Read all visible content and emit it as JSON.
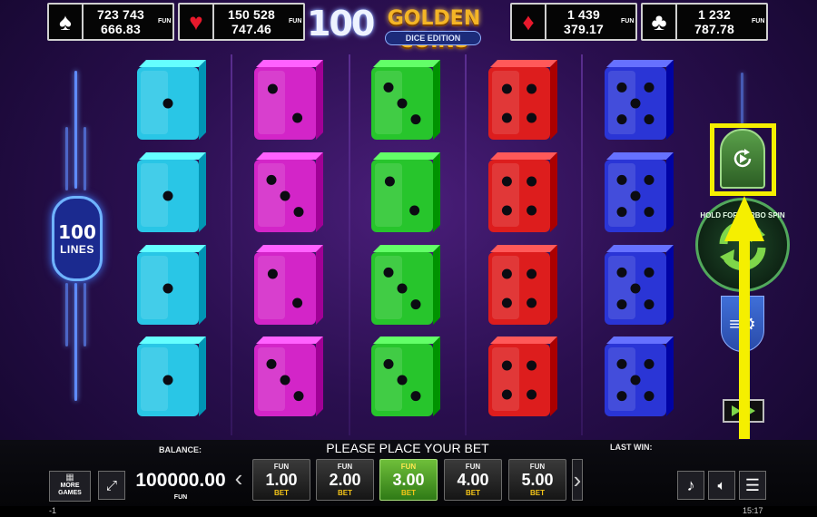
{
  "jackpots": [
    {
      "suit": "spade",
      "glyph": "♠",
      "color": "#ffffff",
      "value": "723 743 666.83",
      "fun": "FUN"
    },
    {
      "suit": "heart",
      "glyph": "♥",
      "color": "#e8192c",
      "value": "150 528 747.46",
      "fun": "FUN"
    },
    {
      "suit": "diamond",
      "glyph": "♦",
      "color": "#e8192c",
      "value": "1 439 379.17",
      "fun": "FUN"
    },
    {
      "suit": "club",
      "glyph": "♣",
      "color": "#ffffff",
      "value": "1 232 787.78",
      "fun": "FUN"
    }
  ],
  "logo": {
    "number": "100",
    "title": "GOLDEN COINS",
    "subtitle": "DICE EDITION"
  },
  "lines": {
    "count": "100",
    "label": "LINES"
  },
  "reels": [
    {
      "color": "#29c6e6",
      "dice": [
        1,
        1,
        1,
        1
      ]
    },
    {
      "color": "#d325c8",
      "dice": [
        2,
        3,
        2,
        3
      ]
    },
    {
      "color": "#27c52c",
      "dice": [
        3,
        2,
        3,
        3
      ]
    },
    {
      "color": "#dd1d1d",
      "dice": [
        4,
        4,
        4,
        4
      ]
    },
    {
      "color": "#2a35d6",
      "dice": [
        5,
        5,
        5,
        5
      ]
    }
  ],
  "controls": {
    "autoplay_icon": "autoplay-icon",
    "spin_hint": "HOLD FOR TURBO SPIN",
    "settings_icon": "settings-icon",
    "play_icon": "play-icon"
  },
  "bottom": {
    "more_games": "MORE GAMES",
    "balance_label": "BALANCE:",
    "balance_value": "100000.00",
    "balance_unit": "FUN",
    "message": "PLEASE PLACE YOUR BET",
    "last_win_label": "LAST WIN:",
    "bets": [
      {
        "fun": "FUN",
        "value": "1.00",
        "label": "BET",
        "active": false
      },
      {
        "fun": "FUN",
        "value": "2.00",
        "label": "BET",
        "active": false
      },
      {
        "fun": "FUN",
        "value": "3.00",
        "label": "BET",
        "active": true
      },
      {
        "fun": "FUN",
        "value": "4.00",
        "label": "BET",
        "active": false
      },
      {
        "fun": "FUN",
        "value": "5.00",
        "label": "BET",
        "active": false
      }
    ],
    "prev_glyph": "‹",
    "next_glyph": "›"
  },
  "status": {
    "left": "-1",
    "time": "15:17"
  },
  "colors": {
    "highlight": "#f5ef00",
    "active_bet": "#4fa52a"
  }
}
